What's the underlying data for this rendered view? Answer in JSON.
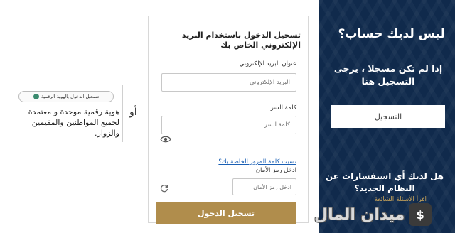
{
  "signup_panel": {
    "title": "ليس لديك حساب؟",
    "text": "إذا لم تكن مسجلا ، يرجى التسجيل هنا",
    "register_button": "التسجيل",
    "question": "هل لديك أي استفسارات عن النظام الجديد؟",
    "faq_link": "اقرأ الأسئلة الشائعة"
  },
  "login_form": {
    "title": "تسجيل الدخول باستخدام البريد الإلكتروني الخاص بك",
    "email_label": "عنوان البريد الإلكتروني",
    "email_placeholder": "البريد الإلكتروني",
    "password_label": "كلمة السر",
    "password_placeholder": "كلمة السر",
    "forgot_password": "نسيت كلمة المرور الخاصة بك؟",
    "captcha_label": "ادخل رمز الأمان",
    "captcha_placeholder": "ادخل رمز الأمان",
    "submit_button": "تسجيل الدخول"
  },
  "separator": {
    "or_label": "أو"
  },
  "digital_id": {
    "badge_label": "تسجيل الدخول بالهوية الرقمية",
    "description": "هوية رقمية موحدة و معتمدة لجميع المواطنين والمقيمين والزوار."
  },
  "watermark": {
    "text": "ميدان المال",
    "logo_glyph": "$"
  },
  "colors": {
    "panel_bg": "#102a4c",
    "gold": "#b08d4c",
    "link": "#1a5fb4"
  }
}
